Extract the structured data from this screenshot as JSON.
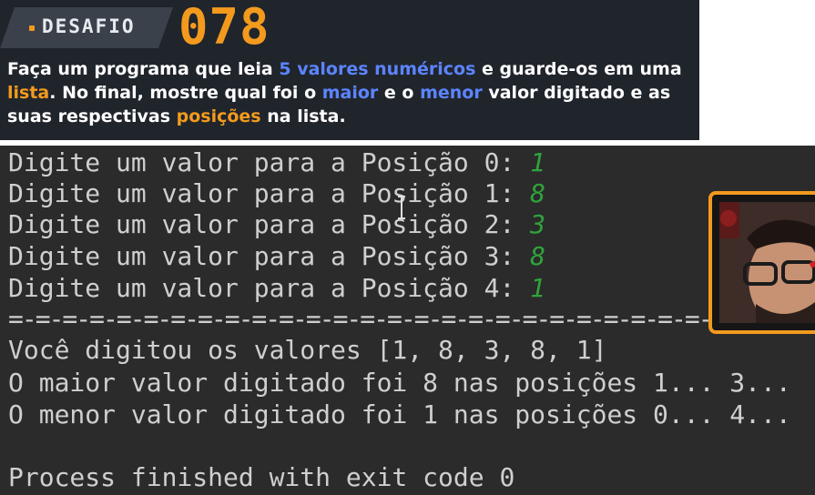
{
  "banner": {
    "tag": "DESAFIO",
    "number": "078",
    "description": {
      "t1": "Faça um programa que leia ",
      "h1": "5 valores numéricos",
      "t2": " e guarde-os em uma ",
      "h2": "lista",
      "t3": ". No final, mostre qual foi o ",
      "h3": "maior",
      "t4": " e o ",
      "h4": "menor",
      "t5": " valor digitado e as suas respectivas ",
      "h5": "posições",
      "t6": " na lista."
    }
  },
  "console": {
    "prompts": [
      {
        "text": "Digite um valor para a Posição 0: ",
        "input": "1"
      },
      {
        "text": "Digite um valor para a Posição 1: ",
        "input": "8"
      },
      {
        "text": "Digite um valor para a Posição 2: ",
        "input": "3"
      },
      {
        "text": "Digite um valor para a Posição 3: ",
        "input": "8"
      },
      {
        "text": "Digite um valor para a Posição 4: ",
        "input": "1"
      }
    ],
    "separator": "=-=-=-=-=-=-=-=-=-=-=-=-=-=-=-=-=-=-=-=-=-=-=-=-=-=-=-=-=-=-",
    "values_line": "Você digitou os valores [1, 8, 3, 8, 1]",
    "max_line": "O maior valor digitado foi 8 nas posições 1... 3...",
    "min_line": "O menor valor digitado foi 1 nas posições 0... 4...",
    "exit_line": "Process finished with exit code 0"
  },
  "colors": {
    "accent_orange": "#f39a1e",
    "accent_blue": "#5c84ff",
    "input_green": "#2fa33b",
    "console_bg": "#2b2b2b"
  }
}
